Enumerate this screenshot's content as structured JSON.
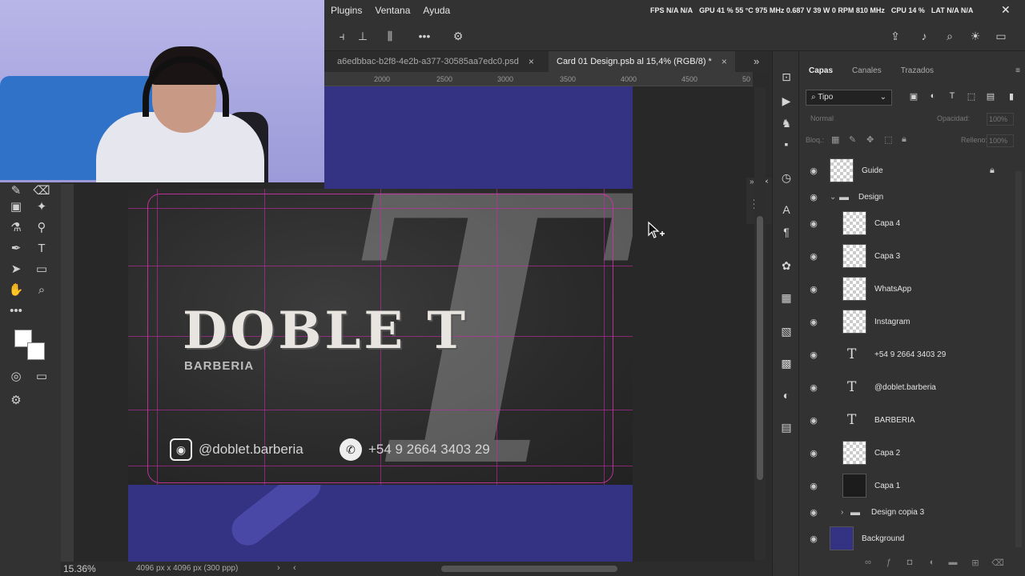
{
  "menubar": {
    "items": [
      "Plugins",
      "Ventana",
      "Ayuda"
    ],
    "status": [
      "FPS N/A N/A",
      "GPU 41 % 55 °C 975 MHz 0.687 V 39 W 0 RPM 810 MHz",
      "CPU 14 %",
      "LAT N/A N/A"
    ]
  },
  "tabs": [
    {
      "label": "a6edbbac-b2f8-4e2b-a377-30585aa7edc0.psd",
      "close": "×"
    },
    {
      "label": "Card 01 Design.psb al 15,4% (RGB/8) *",
      "close": "×"
    }
  ],
  "ruler": {
    "ticks": [
      "2000",
      "2500",
      "3000",
      "3500",
      "4000",
      "4500",
      "50"
    ]
  },
  "card": {
    "title": "DOBLE T",
    "subtitle": "BARBERIA",
    "instagram": "@doblet.barberia",
    "phone": "+54 9 2664 3403 29",
    "big_letter": "T"
  },
  "layers_panel": {
    "tabs": [
      "Capas",
      "Canales",
      "Trazados"
    ],
    "filter": "Tipo",
    "blend_mode": "Normal",
    "opacity_label": "Opacidad:",
    "opacity_value": "100%",
    "lock_label": "Bloq.:",
    "fill_label": "Relleno:",
    "fill_value": "100%",
    "layers": [
      {
        "name": "Guide",
        "kind": "raster"
      },
      {
        "name": "Design",
        "kind": "group"
      },
      {
        "name": "Capa 4",
        "kind": "raster"
      },
      {
        "name": "Capa 3",
        "kind": "raster"
      },
      {
        "name": "WhatsApp",
        "kind": "smart"
      },
      {
        "name": "Instagram",
        "kind": "smart"
      },
      {
        "name": "+54 9 2664 3403 29",
        "kind": "text"
      },
      {
        "name": "@doblet.barberia",
        "kind": "text"
      },
      {
        "name": "BARBERIA",
        "kind": "text"
      },
      {
        "name": "Capa 2",
        "kind": "raster"
      },
      {
        "name": "Capa 1",
        "kind": "dark"
      },
      {
        "name": "Design copia 3",
        "kind": "group"
      },
      {
        "name": "Background",
        "kind": "bg"
      }
    ]
  },
  "statusbar": {
    "zoom": "15.36%",
    "doc_size": "4096 px x 4096 px (300 ppp)"
  },
  "colors": {
    "accent_blue": "#343282",
    "guide_magenta": "#c828aa",
    "panel_bg": "#323232"
  }
}
